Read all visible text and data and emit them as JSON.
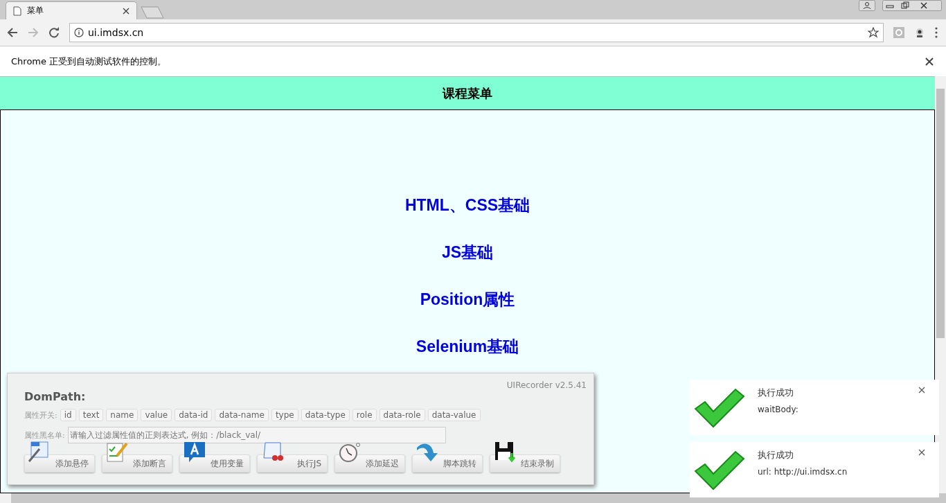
{
  "browser": {
    "tabs": [
      {
        "title": "菜单",
        "selected": true
      }
    ],
    "address": "ui.imdsx.cn",
    "infobar": "Chrome 正受到自动测试软件的控制。"
  },
  "page": {
    "header": "课程菜单",
    "links": [
      "HTML、CSS基础",
      "JS基础",
      "Position属性",
      "Selenium基础"
    ]
  },
  "recorder": {
    "version": "UIRecorder v2.5.41",
    "title": "DomPath:",
    "attr_label": "属性开关:",
    "attributes": [
      "id",
      "text",
      "name",
      "value",
      "data-id",
      "data-name",
      "type",
      "data-type",
      "role",
      "data-role",
      "data-value"
    ],
    "blacklist_label": "属性黑名单:",
    "blacklist_placeholder": "请输入过滤属性值的正则表达式, 例如：/black_val/",
    "buttons": [
      {
        "kind": "hover",
        "label": "添加悬停"
      },
      {
        "kind": "assert",
        "label": "添加断言"
      },
      {
        "kind": "variable",
        "label": "使用变量"
      },
      {
        "kind": "js",
        "label": "执行JS"
      },
      {
        "kind": "delay",
        "label": "添加延迟"
      },
      {
        "kind": "jump",
        "label": "脚本跳转"
      },
      {
        "kind": "save",
        "label": "结束录制"
      }
    ]
  },
  "toasts": [
    {
      "title": "执行成功",
      "message": "waitBody:"
    },
    {
      "title": "执行成功",
      "message": "url: http://ui.imdsx.cn"
    }
  ]
}
